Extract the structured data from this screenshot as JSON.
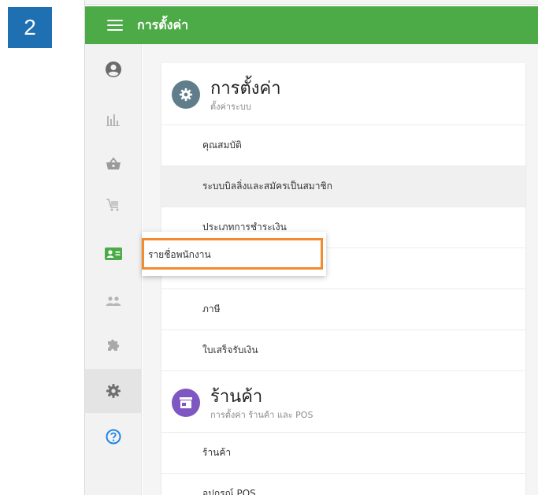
{
  "step": {
    "number": "2"
  },
  "colors": {
    "appbar": "#4caa47",
    "badge": "#1f6fb3",
    "settings_icon": "#607d8b",
    "store_icon": "#7e57c2",
    "highlight": "#f28a2e",
    "active_sidebar_icon": "#4caa47",
    "help_icon": "#1e88e5"
  },
  "appbar": {
    "title": "การตั้งค่า",
    "menu_icon": "hamburger-menu-icon"
  },
  "sidebar": {
    "items": [
      {
        "icon": "account-circle-icon"
      },
      {
        "icon": "bar-chart-icon"
      },
      {
        "icon": "basket-icon"
      },
      {
        "icon": "cart-icon"
      },
      {
        "icon": "employee-card-icon"
      },
      {
        "icon": "people-icon"
      },
      {
        "icon": "puzzle-icon"
      },
      {
        "icon": "gear-icon"
      },
      {
        "icon": "help-icon"
      }
    ]
  },
  "settings_section": {
    "title": "การตั้งค่า",
    "subtitle": "ตั้งค่าระบบ",
    "icon": "gear-icon",
    "items": [
      {
        "label": "คุณสมบัติ"
      },
      {
        "label": "ระบบบิลลิ่งและสมัครเป็นสมาชิก"
      },
      {
        "label": "ประเภทการชำระเงิน"
      },
      {
        "label": ""
      },
      {
        "label": "ภาษี"
      },
      {
        "label": "ใบเสร็จรับเงิน"
      }
    ]
  },
  "store_section": {
    "title": "ร้านค้า",
    "subtitle": "การตั้งค่า ร้านค้า และ POS",
    "icon": "store-icon",
    "items": [
      {
        "label": "ร้านค้า"
      },
      {
        "label": "อุปกรณ์ POS"
      }
    ]
  },
  "tooltip": {
    "label": "รายชื่อพนักงาน"
  }
}
